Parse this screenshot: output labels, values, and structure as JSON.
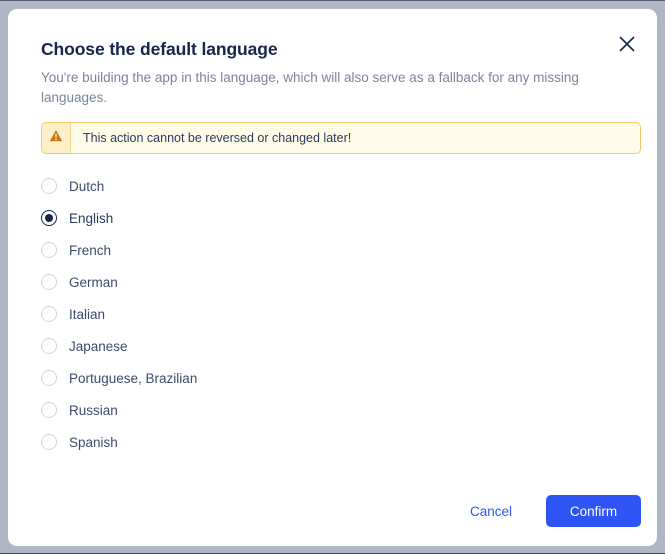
{
  "dialog": {
    "title": "Choose the default language",
    "subtitle": "You're building the app in this language, which will also serve as a fallback for any missing languages.",
    "close_icon": "close-icon"
  },
  "warning": {
    "icon": "warning-triangle-icon",
    "message": "This action cannot be reversed or changed later!",
    "background_color": "#fefce8",
    "border_color": "#f5c86a",
    "icon_color": "#c8791a"
  },
  "languages": {
    "selected": "English",
    "options": [
      {
        "label": "Dutch",
        "selected": false
      },
      {
        "label": "English",
        "selected": true
      },
      {
        "label": "French",
        "selected": false
      },
      {
        "label": "German",
        "selected": false
      },
      {
        "label": "Italian",
        "selected": false
      },
      {
        "label": "Japanese",
        "selected": false
      },
      {
        "label": "Portuguese, Brazilian",
        "selected": false
      },
      {
        "label": "Russian",
        "selected": false
      },
      {
        "label": "Spanish",
        "selected": false
      }
    ]
  },
  "footer": {
    "cancel_label": "Cancel",
    "confirm_label": "Confirm",
    "accent_color": "#2f54f5"
  }
}
